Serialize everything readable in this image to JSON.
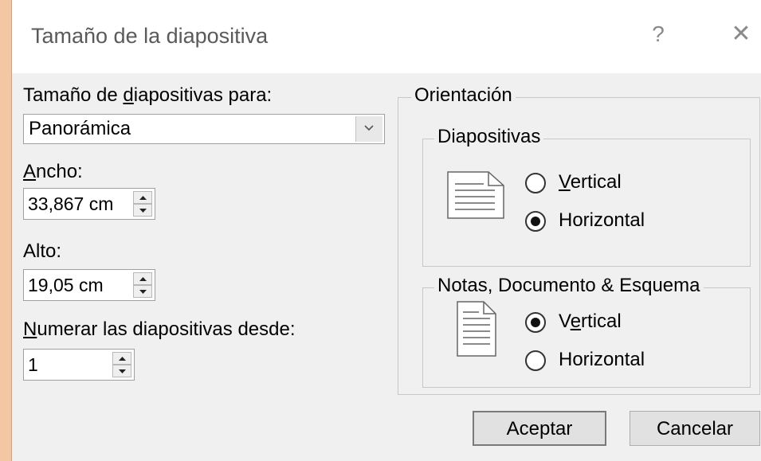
{
  "dialog": {
    "title": "Tamaño de la diapositiva",
    "help_icon": "?",
    "close_icon": "✕"
  },
  "slide_size": {
    "label_pre": "Tamaño de ",
    "label_mnemonic": "d",
    "label_post": "iapositivas para:",
    "selected": "Panorámica"
  },
  "width": {
    "label_mnemonic": "A",
    "label_post": "ncho:",
    "value": "33,867 cm"
  },
  "height": {
    "label": "Alto:",
    "value": "19,05 cm"
  },
  "numbering": {
    "label_mnemonic": "N",
    "label_post": "umerar las diapositivas desde:",
    "value": "1"
  },
  "orientation": {
    "legend": "Orientación",
    "slides": {
      "legend": "Diapositivas",
      "vertical_mnemonic": "V",
      "vertical_post": "ertical",
      "horizontal": "Horizontal",
      "selected": "horizontal"
    },
    "notes": {
      "legend": "Notas, Documento & Esquema",
      "vertical_pre": "V",
      "vertical_mnemonic": "e",
      "vertical_post": "rtical",
      "horizontal": "Horizontal",
      "selected": "vertical"
    }
  },
  "buttons": {
    "ok": "Aceptar",
    "cancel": "Cancelar"
  }
}
